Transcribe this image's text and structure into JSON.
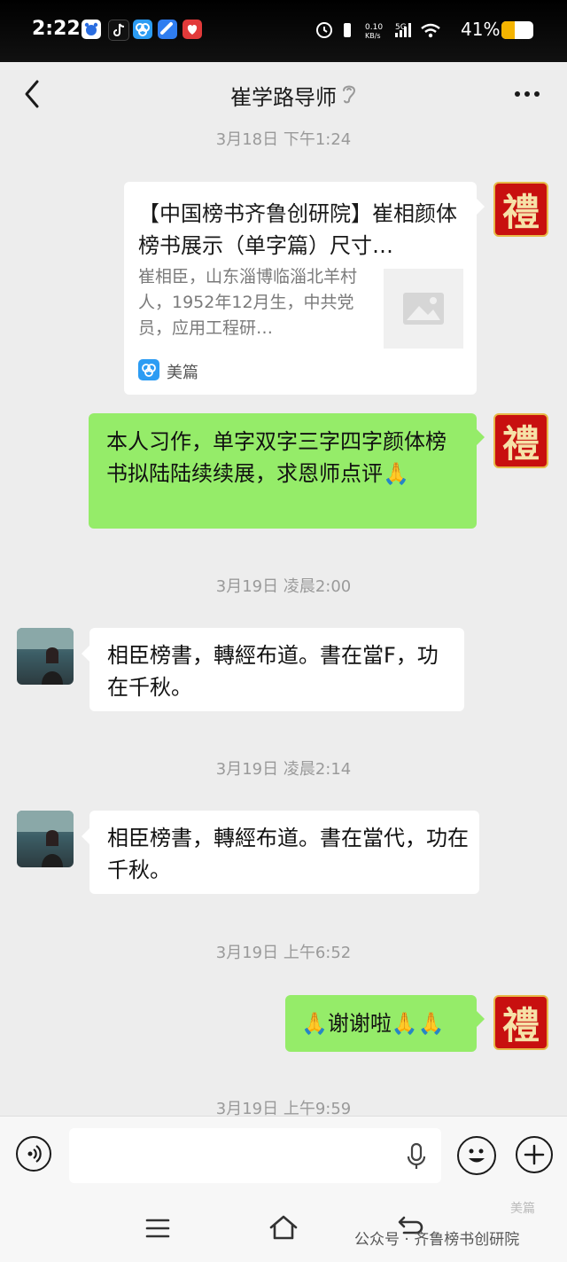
{
  "status_bar": {
    "time": "2:22",
    "net_speed": "0.10\nKB/s",
    "battery_text": "41%",
    "battery_level": 0.41,
    "colors": {
      "bg": "#000000",
      "text": "#ffffff",
      "battery": "#f5b400"
    }
  },
  "header": {
    "title": "崔学路导师",
    "back_icon": "chevron-left-icon",
    "ear_icon": "ear-icon",
    "more_icon": "more-dots-icon"
  },
  "messages": {
    "ts1": "3月18日 下午1:24",
    "card": {
      "title": "【中国榜书齐鲁创研院】崔相颜体榜书展示（单字篇）尺寸…",
      "description": "崔相臣，山东淄博临淄北羊村人，1952年12月生，中共党员，应用工程研…",
      "source": "美篇"
    },
    "msg1": "本人习作，单字双字三字四字颜体榜书拟陆陆续续展，求恩师点评🙏",
    "ts2": "3月19日 凌晨2:00",
    "msg2": "相臣榜書，轉經布道。書在當F，功在千秋。",
    "ts3": "3月19日 凌晨2:14",
    "msg3": "相臣榜書，轉經布道。書在當代，功在千秋。",
    "ts4": "3月19日 上午6:52",
    "msg4": "🙏谢谢啦🙏🙏",
    "ts5": "3月19日 上午9:59",
    "self_avatar_char": "禮"
  },
  "input_bar": {
    "placeholder": "",
    "voice_icon": "voice-icon",
    "mic_icon": "mic-icon",
    "emoji_icon": "emoji-icon",
    "plus_icon": "plus-icon"
  },
  "nav_bar": {
    "menu_icon": "menu-icon",
    "home_icon": "home-icon",
    "back_icon": "nav-back-icon"
  },
  "watermark": {
    "text": "公众号 · 齐鲁榜书创研院",
    "corner": "美篇"
  },
  "colors": {
    "background": "#ededed",
    "bubble_green": "#95ec69",
    "bubble_white": "#ffffff",
    "timestamp": "#9a9a9a",
    "avatar_red": "#c8100f"
  }
}
